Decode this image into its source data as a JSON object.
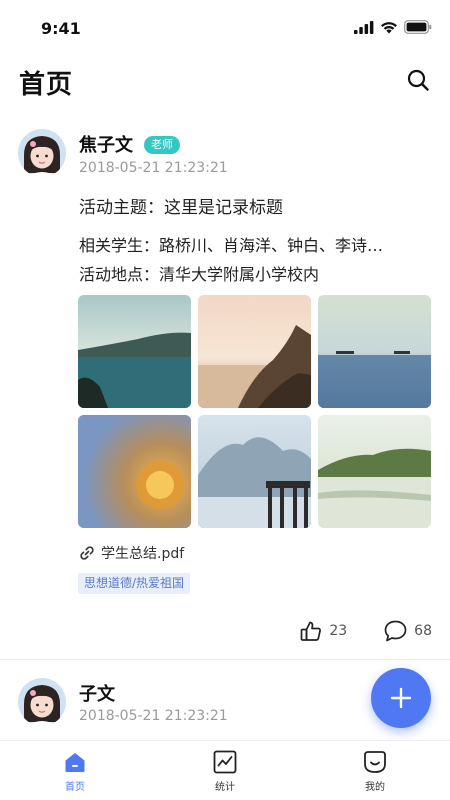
{
  "status_bar": {
    "time": "9:41"
  },
  "header": {
    "title": "首页"
  },
  "posts": [
    {
      "author": "焦子文",
      "role": "老师",
      "time": "2018-05-21  21:23:21",
      "subject": "活动主题：这里是记录标题",
      "students": "相关学生：路桥川、肖海洋、钟白、李诗…",
      "location": "活动地点：清华大学附属小学校内",
      "attachment": "学生总结.pdf",
      "tag": "思想道德/热爱祖国",
      "likes": "23",
      "comments": "68"
    },
    {
      "author": "子文",
      "time": "2018-05-21  21:23:21"
    }
  ],
  "tabs": [
    {
      "label": "首页",
      "icon": "home-icon",
      "active": true
    },
    {
      "label": "统计",
      "icon": "chart-icon",
      "active": false
    },
    {
      "label": "我的",
      "icon": "smile-icon",
      "active": false
    }
  ],
  "colors": {
    "accent": "#4f78f2",
    "badge": "#36c6c4",
    "tag_bg": "#e8eefb",
    "tag_text": "#5a79c8"
  }
}
